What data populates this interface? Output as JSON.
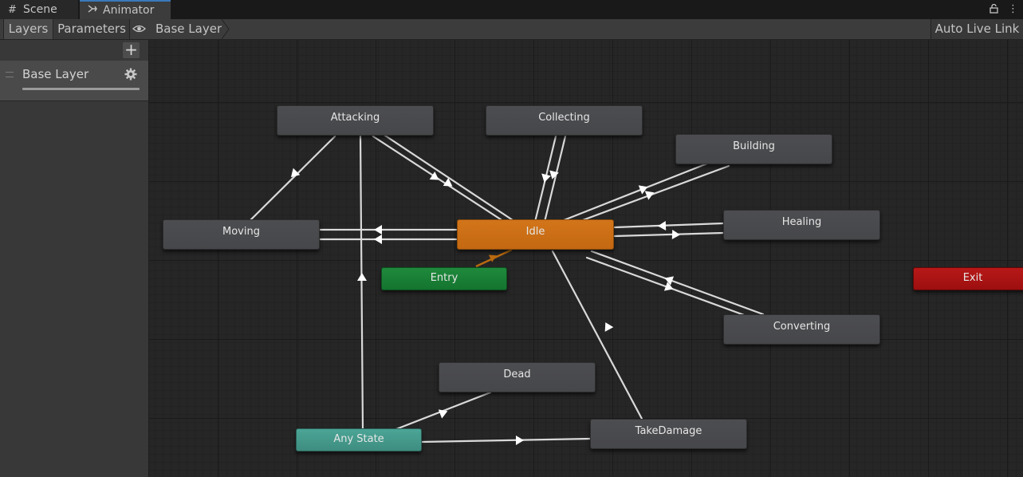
{
  "tabs": {
    "scene": {
      "label": "Scene",
      "icon": "grid-icon"
    },
    "animator": {
      "label": "Animator",
      "icon": "animator-icon"
    }
  },
  "toolbar": {
    "layers_label": "Layers",
    "parameters_label": "Parameters",
    "breadcrumb": "Base Layer",
    "auto_live_link": "Auto Live Link"
  },
  "layers_panel": {
    "layers": [
      {
        "name": "Base Layer"
      }
    ]
  },
  "states": {
    "attacking": "Attacking",
    "collecting": "Collecting",
    "building": "Building",
    "moving": "Moving",
    "idle": "Idle",
    "healing": "Healing",
    "entry": "Entry",
    "exit": "Exit",
    "converting": "Converting",
    "dead": "Dead",
    "any_state": "Any State",
    "take_damage": "TakeDamage"
  },
  "colors": {
    "default_state": "#48494c",
    "default_state_idle": "#c96d14",
    "entry": "#198035",
    "exit": "#a81313",
    "any_state": "#44998a",
    "transition": "#e6e6e6",
    "entry_transition": "#b86a10",
    "active_tab_accent": "#3a79bb"
  },
  "transitions": [
    {
      "from": "Attacking",
      "to": "Moving"
    },
    {
      "from": "Attacking",
      "to": "Idle"
    },
    {
      "from": "Idle",
      "to": "Attacking"
    },
    {
      "from": "Collecting",
      "to": "Idle"
    },
    {
      "from": "Idle",
      "to": "Collecting"
    },
    {
      "from": "Building",
      "to": "Idle"
    },
    {
      "from": "Idle",
      "to": "Building"
    },
    {
      "from": "Idle",
      "to": "Moving"
    },
    {
      "from": "Moving",
      "to": "Idle"
    },
    {
      "from": "Healing",
      "to": "Idle"
    },
    {
      "from": "Idle",
      "to": "Healing"
    },
    {
      "from": "Converting",
      "to": "Idle"
    },
    {
      "from": "Idle",
      "to": "Converting"
    },
    {
      "from": "TakeDamage",
      "to": "Idle"
    },
    {
      "from": "Any State",
      "to": "Attacking"
    },
    {
      "from": "Any State",
      "to": "Dead"
    },
    {
      "from": "Any State",
      "to": "TakeDamage"
    },
    {
      "from": "Entry",
      "to": "Idle"
    }
  ]
}
